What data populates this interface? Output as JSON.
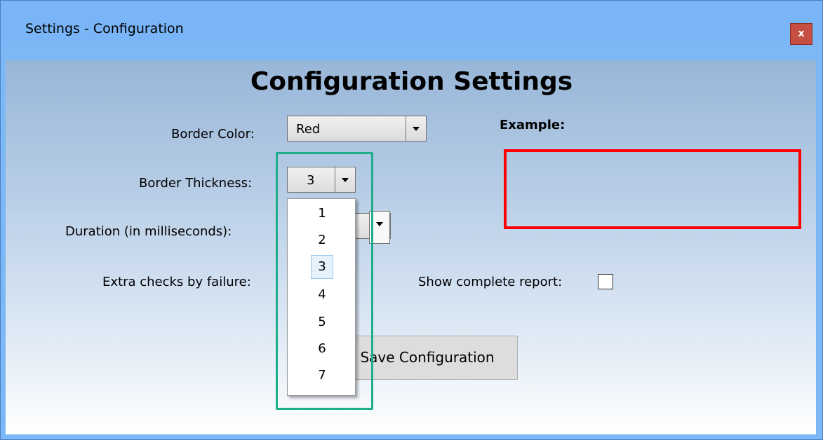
{
  "window": {
    "title": "Settings - Configuration",
    "close_label": "x"
  },
  "heading": "Configuration Settings",
  "fields": {
    "border_color": {
      "label": "Border Color:",
      "value": "Red"
    },
    "border_thickness": {
      "label": "Border Thickness:",
      "value": "3"
    },
    "duration": {
      "label": "Duration (in milliseconds):"
    },
    "extra_checks": {
      "label": "Extra checks by failure:"
    },
    "show_report": {
      "label": "Show complete report:",
      "checked": false
    }
  },
  "example": {
    "label": "Example:",
    "border_color": "#ff0000"
  },
  "save_button": {
    "label": "Save Configuration",
    "visible_text": "ave Configuration"
  },
  "thickness_dropdown": {
    "options": [
      "1",
      "2",
      "3",
      "4",
      "5",
      "6",
      "7"
    ],
    "selected": "3"
  },
  "colors": {
    "titlebar": "#79b5f7",
    "highlight": "#1fae8b",
    "close_button": "#c54f43"
  }
}
